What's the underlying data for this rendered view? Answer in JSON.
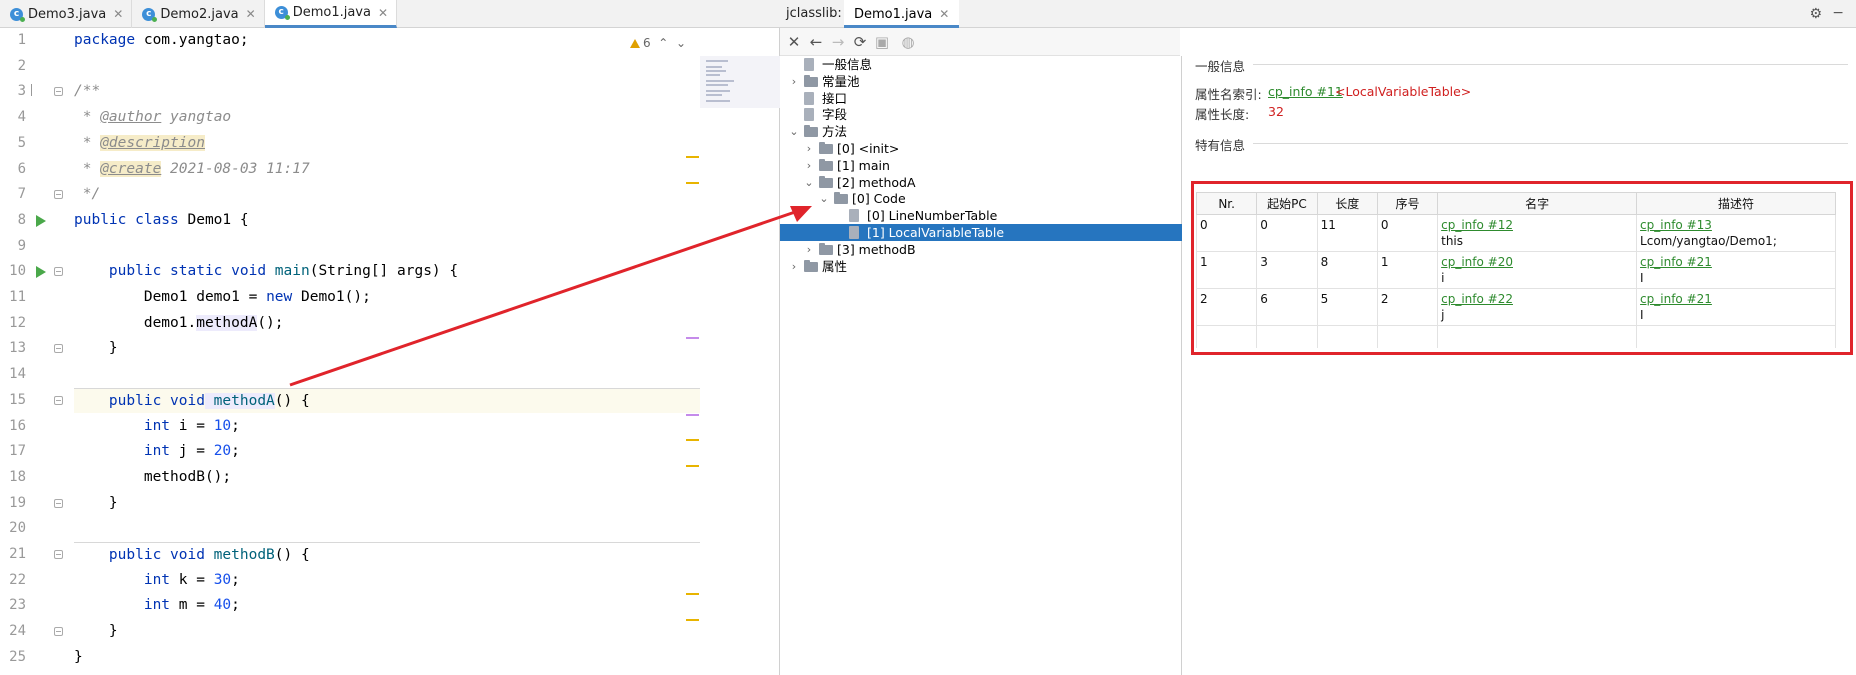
{
  "editor": {
    "tabs": [
      {
        "label": "Demo3.java",
        "active": false
      },
      {
        "label": "Demo2.java",
        "active": false
      },
      {
        "label": "Demo1.java",
        "active": true
      }
    ],
    "warnings_count": "6",
    "line_numbers": [
      "1",
      "2",
      "3",
      "4",
      "5",
      "6",
      "7",
      "8",
      "9",
      "10",
      "11",
      "12",
      "13",
      "14",
      "15",
      "16",
      "17",
      "18",
      "19",
      "20",
      "21",
      "22",
      "23",
      "24",
      "25"
    ],
    "code": {
      "l1_kw": "package",
      "l1_rest": " com.yangtao;",
      "l3": "/**",
      "l4_pre": " * ",
      "l4_tag": "@author",
      "l4_rest": " yangtao",
      "l5_pre": " * ",
      "l5_tag": "@description",
      "l6_pre": " * ",
      "l6_tag": "@create",
      "l6_rest": " 2021-08-03 11:17",
      "l7": " */",
      "l8_kw": "public class",
      "l8_rest": " Demo1 {",
      "l10_kw": "    public static void",
      "l10_fn": " main",
      "l10_rest": "(String[] args) {",
      "l11_a": "        Demo1 demo1 = ",
      "l11_kw": "new",
      "l11_b": " Demo1();",
      "l12_a": "        demo1.",
      "l12_fn": "methodA",
      "l12_b": "();",
      "l13": "    }",
      "l15_kw": "    public void",
      "l15_fn": " methodA",
      "l15_rest": "() {",
      "l16_kw": "        int",
      "l16_a": " i = ",
      "l16_num": "10",
      "l16_b": ";",
      "l17_kw": "        int",
      "l17_a": " j = ",
      "l17_num": "20",
      "l17_b": ";",
      "l18": "        methodB();",
      "l19": "    }",
      "l21_kw": "    public void",
      "l21_fn": " methodB",
      "l21_rest": "() {",
      "l22_kw": "        int",
      "l22_a": " k = ",
      "l22_num": "30",
      "l22_b": ";",
      "l23_kw": "        int",
      "l23_a": " m = ",
      "l23_num": "40",
      "l23_b": ";",
      "l24": "    }",
      "l25": "}"
    }
  },
  "viewer": {
    "title": "jclasslib:",
    "tab": "Demo1.java",
    "tree": [
      {
        "label": "一般信息",
        "indent": 0,
        "arrow": "",
        "icon": "file"
      },
      {
        "label": "常量池",
        "indent": 0,
        "arrow": "›",
        "icon": "folder"
      },
      {
        "label": "接口",
        "indent": 0,
        "arrow": "",
        "icon": "file"
      },
      {
        "label": "字段",
        "indent": 0,
        "arrow": "",
        "icon": "file"
      },
      {
        "label": "方法",
        "indent": 0,
        "arrow": "⌄",
        "icon": "folder"
      },
      {
        "label": "[0] <init>",
        "indent": 1,
        "arrow": "›",
        "icon": "folder"
      },
      {
        "label": "[1] main",
        "indent": 1,
        "arrow": "›",
        "icon": "folder"
      },
      {
        "label": "[2] methodA",
        "indent": 1,
        "arrow": "⌄",
        "icon": "folder"
      },
      {
        "label": "[0] Code",
        "indent": 2,
        "arrow": "⌄",
        "icon": "folder"
      },
      {
        "label": "[0] LineNumberTable",
        "indent": 3,
        "arrow": "",
        "icon": "file"
      },
      {
        "label": "[1] LocalVariableTable",
        "indent": 3,
        "arrow": "",
        "icon": "file",
        "selected": true
      },
      {
        "label": "[3] methodB",
        "indent": 1,
        "arrow": "›",
        "icon": "folder"
      },
      {
        "label": "属性",
        "indent": 0,
        "arrow": "›",
        "icon": "folder"
      }
    ],
    "general_section": "一般信息",
    "name_index_label": "属性名索引:",
    "name_index_link": "cp_info #11",
    "name_index_value": "<LocalVariableTable>",
    "length_label": "属性长度:",
    "length_value": "32",
    "specific_section": "特有信息",
    "table": {
      "headers": [
        "Nr.",
        "起始PC",
        "长度",
        "序号",
        "名字",
        "描述符"
      ],
      "rows": [
        {
          "nr": "0",
          "pc": "0",
          "len": "11",
          "idx": "0",
          "name_link": "cp_info #12",
          "name": "this",
          "desc_link": "cp_info #13",
          "desc": "Lcom/yangtao/Demo1;"
        },
        {
          "nr": "1",
          "pc": "3",
          "len": "8",
          "idx": "1",
          "name_link": "cp_info #20",
          "name": "i",
          "desc_link": "cp_info #21",
          "desc": "I"
        },
        {
          "nr": "2",
          "pc": "6",
          "len": "5",
          "idx": "2",
          "name_link": "cp_info #22",
          "name": "j",
          "desc_link": "cp_info #21",
          "desc": "I"
        }
      ]
    }
  },
  "colors": {
    "accent": "#2675bf",
    "highlight_box": "#e0242b",
    "link": "#2e8b2e"
  }
}
